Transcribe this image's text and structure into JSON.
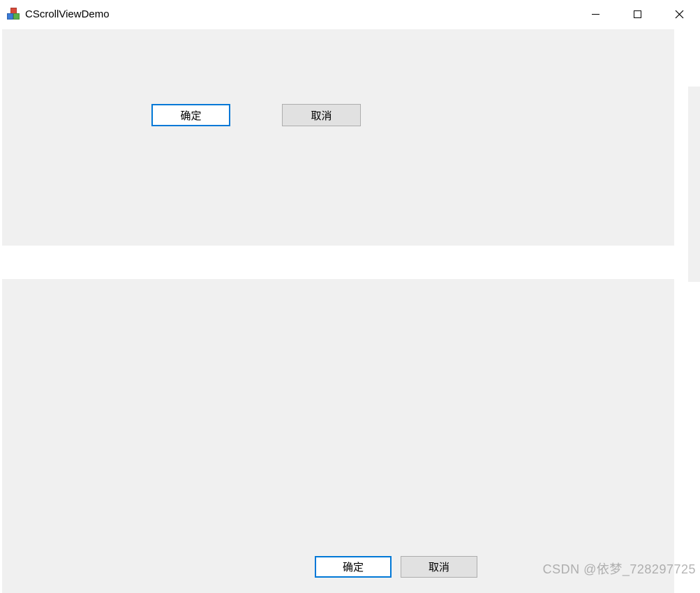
{
  "window": {
    "title": "CScrollViewDemo"
  },
  "panels": {
    "top": {
      "ok_label": "确定",
      "cancel_label": "取消"
    },
    "bottom": {
      "ok_label": "确定",
      "cancel_label": "取消"
    }
  },
  "watermark": "CSDN @依梦_728297725"
}
